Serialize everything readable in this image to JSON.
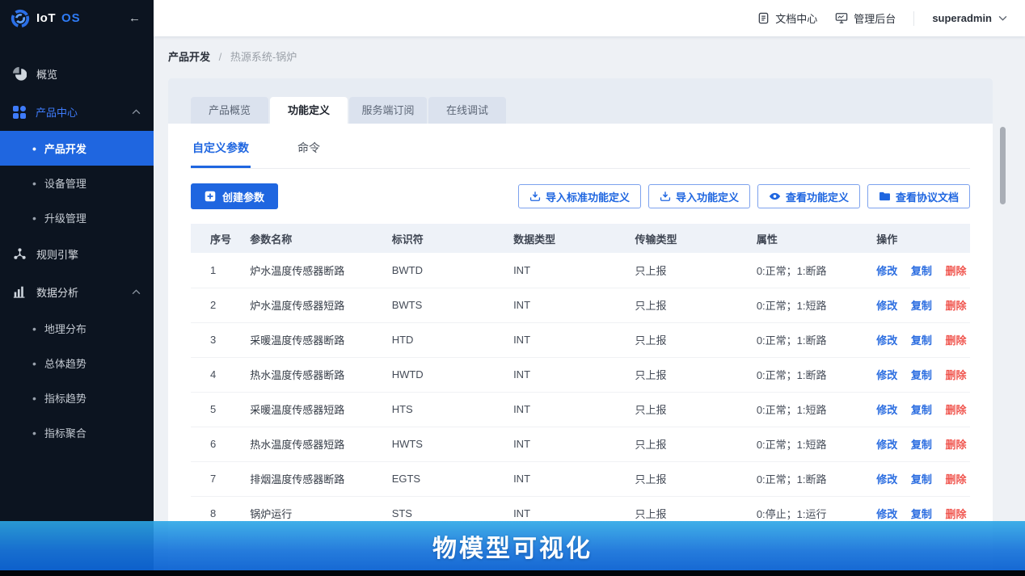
{
  "sidebar": {
    "brand_iot": "IoT",
    "brand_os": "OS",
    "collapse_icon": "←",
    "menu": {
      "overview": "概览",
      "product_center": "产品中心",
      "product_dev": "产品开发",
      "device_mgmt": "设备管理",
      "upgrade_mgmt": "升级管理",
      "rule_engine": "规则引擎",
      "data_analysis": "数据分析",
      "geo_distribution": "地理分布",
      "overall_trend": "总体趋势",
      "metric_trend": "指标趋势",
      "metric_aggregation": "指标聚合"
    }
  },
  "header": {
    "doc_center": "文档中心",
    "admin_console": "管理后台",
    "username": "superadmin"
  },
  "breadcrumb": {
    "root": "产品开发",
    "separator": "/",
    "current": "热源系统-锅炉"
  },
  "tabs": [
    "产品概览",
    "功能定义",
    "服务端订阅",
    "在线调试"
  ],
  "subtabs": {
    "custom_params": "自定义参数",
    "commands": "命令"
  },
  "toolbar": {
    "create_param": "创建参数",
    "import_standard": "导入标准功能定义",
    "import_def": "导入功能定义",
    "view_def": "查看功能定义",
    "view_protocol": "查看协议文档"
  },
  "table": {
    "headers": [
      "序号",
      "参数名称",
      "标识符",
      "数据类型",
      "传输类型",
      "属性",
      "操作"
    ],
    "actions": {
      "modify": "修改",
      "copy": "复制",
      "delete": "删除"
    },
    "rows": [
      {
        "num": "1",
        "name": "炉水温度传感器断路",
        "identifier": "BWTD",
        "data_type": "INT",
        "transmission": "只上报",
        "attribute": "0:正常；1:断路"
      },
      {
        "num": "2",
        "name": "炉水温度传感器短路",
        "identifier": "BWTS",
        "data_type": "INT",
        "transmission": "只上报",
        "attribute": "0:正常；1:短路"
      },
      {
        "num": "3",
        "name": "采暖温度传感器断路",
        "identifier": "HTD",
        "data_type": "INT",
        "transmission": "只上报",
        "attribute": "0:正常；1:断路"
      },
      {
        "num": "4",
        "name": "热水温度传感器断路",
        "identifier": "HWTD",
        "data_type": "INT",
        "transmission": "只上报",
        "attribute": "0:正常；1:断路"
      },
      {
        "num": "5",
        "name": "采暖温度传感器短路",
        "identifier": "HTS",
        "data_type": "INT",
        "transmission": "只上报",
        "attribute": "0:正常；1:短路"
      },
      {
        "num": "6",
        "name": "热水温度传感器短路",
        "identifier": "HWTS",
        "data_type": "INT",
        "transmission": "只上报",
        "attribute": "0:正常；1:短路"
      },
      {
        "num": "7",
        "name": "排烟温度传感器断路",
        "identifier": "EGTS",
        "data_type": "INT",
        "transmission": "只上报",
        "attribute": "0:正常；1:断路"
      },
      {
        "num": "8",
        "name": "锅炉运行",
        "identifier": "STS",
        "data_type": "INT",
        "transmission": "只上报",
        "attribute": "0:停止；1:运行"
      }
    ]
  },
  "banner": {
    "title": "物模型可视化"
  },
  "colors": {
    "accent": "#1f66e0",
    "danger": "#f0564f",
    "sidebar_bg": "#0c1420",
    "banner_top": "#2ca7e6",
    "banner_bottom": "#0d63d2"
  }
}
